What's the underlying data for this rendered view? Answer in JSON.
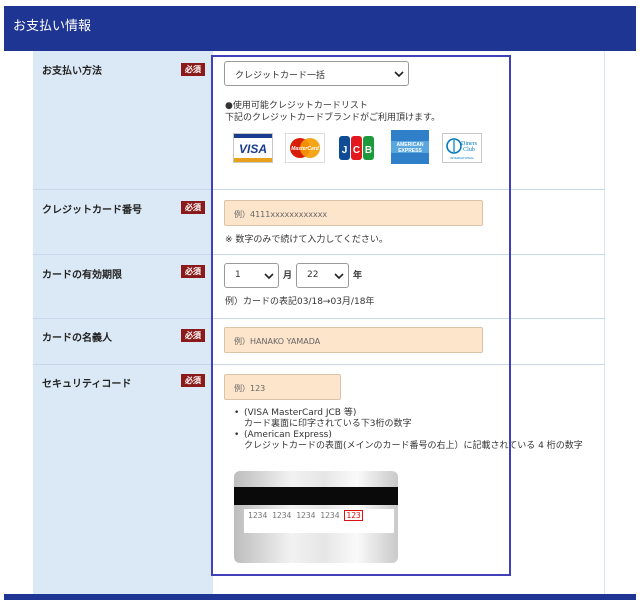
{
  "section": {
    "title": "お支払い情報"
  },
  "required_label": "必須",
  "payment_method": {
    "label": "お支払い方法",
    "selected": "クレジットカード一括",
    "note_line1": "●使用可能クレジットカードリスト",
    "note_line2": "下記のクレジットカードブランドがご利用頂けます。",
    "brands": [
      "VISA",
      "MasterCard",
      "JCB",
      "American Express",
      "Diners Club International"
    ]
  },
  "card_number": {
    "label": "クレジットカード番号",
    "placeholder": "例）4111xxxxxxxxxxxx",
    "hint": "※ 数字のみで続けて入力してください。"
  },
  "expiry": {
    "label": "カードの有効期限",
    "month_value": "1",
    "month_unit": "月",
    "year_value": "22",
    "year_unit": "年",
    "hint": "例）カードの表記03/18→03月/18年"
  },
  "holder": {
    "label": "カードの名義人",
    "placeholder": "例）HANAKO YAMADA"
  },
  "security": {
    "label": "セキュリティコード",
    "placeholder": "例）123",
    "bullets": [
      {
        "title": "(VISA MasterCard JCB 等)",
        "desc": "カード裏面に印字されている下3桁の数字"
      },
      {
        "title": "(American Express)",
        "desc": "クレジットカードの表面(メインのカード番号の右上）に記載されている 4 桁の数字"
      }
    ],
    "card_digits": [
      "1234",
      "1234",
      "1234",
      "1234"
    ],
    "card_code": "123"
  },
  "colors": {
    "header": "#1f3593",
    "label_bg": "#dbe9f6",
    "input_bg": "#fde5cc",
    "required_badge": "#8b1a1a",
    "focus_border": "#4040b8"
  }
}
